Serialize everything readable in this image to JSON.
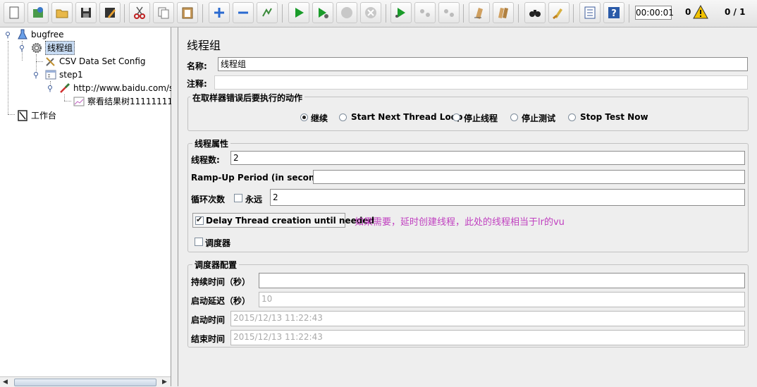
{
  "toolbar": {
    "buttons": [
      "new-icon",
      "templates-icon",
      "open-icon",
      "save-icon",
      "save-as-icon",
      "cut-icon",
      "copy-icon",
      "paste-icon",
      "expand-icon",
      "collapse-icon",
      "toggle-icon",
      "start-icon",
      "start-no-pause-icon",
      "stop-icon",
      "shutdown-icon",
      "remote-start-icon",
      "remote-stop-icon",
      "remote-shutdown-icon",
      "clear-icon",
      "clear-all-icon",
      "search-icon",
      "reset-search-icon",
      "function-helper-icon",
      "help-icon"
    ],
    "timer": "00:00:01",
    "error_count": "0",
    "thread_count": "0 / 1"
  },
  "tree": {
    "test_plan": "bugfree",
    "thread_group": "线程组",
    "csv_config": "CSV Data Set Config",
    "step": "step1",
    "sampler": "http://www.baidu.com/s",
    "listener": "察看结果树11111111",
    "workbench": "工作台"
  },
  "main": {
    "title": "线程组",
    "name_label": "名称:",
    "name_value": "线程组",
    "comment_label": "注释:",
    "comment_value": "",
    "error_action": {
      "title": "在取样器错误后要执行的动作",
      "options": [
        "继续",
        "Start Next Thread Loop",
        "停止线程",
        "停止测试",
        "Stop Test Now"
      ],
      "selected": "继续"
    },
    "thread_props": {
      "title": "线程属性",
      "threads_label": "线程数:",
      "threads_value": "2",
      "rampup_label": "Ramp-Up Period (in seconds):",
      "rampup_value": "",
      "loop_label": "循环次数",
      "forever_label": "永远",
      "forever_checked": false,
      "loop_value": "2",
      "delay_label": "Delay Thread creation until needed",
      "delay_checked": true,
      "scheduler_label": "调度器",
      "scheduler_checked": false
    },
    "annotation": "如果需要，延时创建线程，此处的线程相当于lr的vu",
    "scheduler": {
      "title": "调度器配置",
      "duration_label": "持续时间（秒）",
      "duration_value": "",
      "delay_label": "启动延迟（秒）",
      "delay_value": "10",
      "start_label": "启动时间",
      "start_value": "2015/12/13 11:22:43",
      "end_label": "结束时间",
      "end_value": "2015/12/13 11:22:43"
    }
  },
  "colors": {
    "accent_green": "#1a9c2a",
    "annotation": "#c040c0",
    "selection": "#c8dcf4"
  }
}
